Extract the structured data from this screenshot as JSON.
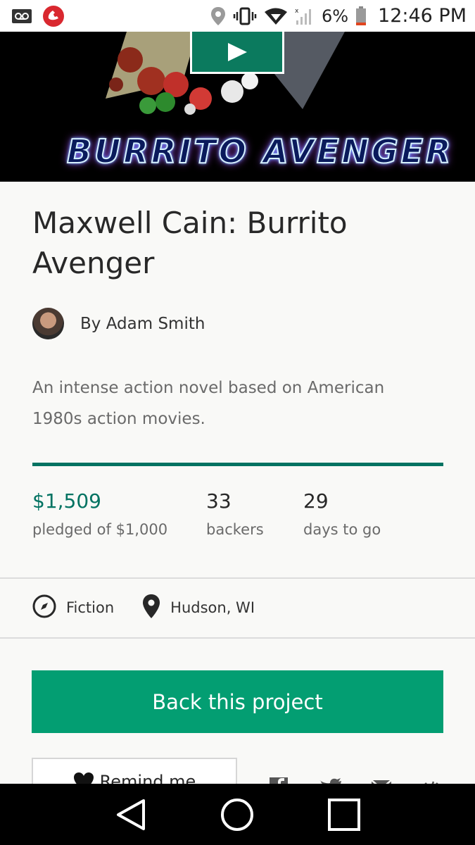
{
  "status_bar": {
    "battery": "6%",
    "time": "12:46 PM",
    "icons": [
      "voicemail-icon",
      "missed-call-icon",
      "location-icon",
      "vibrate-icon",
      "wifi-icon",
      "signal-icon",
      "battery-icon"
    ]
  },
  "hero": {
    "logo_text": "BURRITO AVENGER",
    "play_icon": "play-icon"
  },
  "project": {
    "title": "Maxwell Cain: Burrito Avenger",
    "creator": "By Adam Smith",
    "blurb": "An intense action novel based on American 1980s action movies.",
    "progress_fraction": 1.0
  },
  "stats": {
    "pledged": "$1,509",
    "pledged_label": "pledged of $1,000",
    "backers": "33",
    "backers_label": "backers",
    "days": "29",
    "days_label": "days to go"
  },
  "meta": {
    "category": "Fiction",
    "location": "Hudson, WI"
  },
  "actions": {
    "back_label": "Back this project",
    "remind_label": "Remind me",
    "share_icons": [
      "facebook-icon",
      "twitter-icon",
      "email-icon",
      "embed-icon"
    ]
  },
  "colors": {
    "accent": "#039e72",
    "accent_dark": "#037362"
  }
}
